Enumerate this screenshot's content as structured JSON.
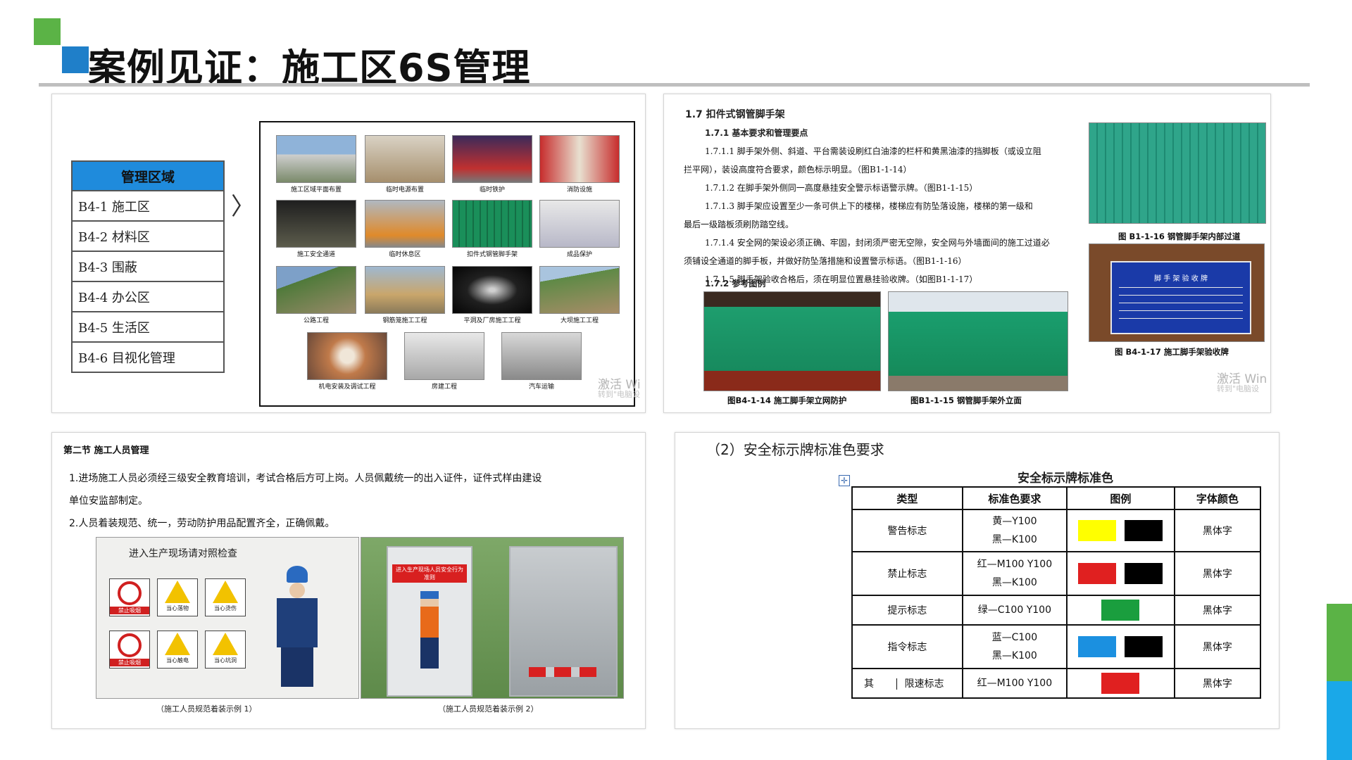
{
  "header": {
    "title": "案例见证：施工区6S管理"
  },
  "panel1": {
    "table_header": "管理区域",
    "areas": [
      "B4-1  施工区",
      "B4-2  材料区",
      "B4-3  围蔽",
      "B4-4  办公区",
      "B4-5  生活区",
      "B4-6  目视化管理"
    ],
    "arrow_glyph": "〉",
    "photo_captions": [
      "施工区域平面布置",
      "临时电源布置",
      "临时铁护",
      "消防设施",
      "施工安全通道",
      "临时休息区",
      "扣件式钢管脚手架",
      "成品保护",
      "公路工程",
      "钢筋笼施工工程",
      "平洞及厂房施工工程",
      "大坝施工工程",
      "机电安装及调试工程",
      "房建工程",
      "汽车运输"
    ],
    "watermark": "激活 Wi",
    "watermark_sub": "转到\"电脑设"
  },
  "panel2": {
    "heading": "1.7  扣件式钢管脚手架",
    "subheading": "1.7.1 基本要求和管理要点",
    "para1a": "1.7.1.1  脚手架外侧、斜道、平台需装设刷红白油漆的栏杆和黄黑油漆的挡脚板（或设立阻",
    "para1b": "拦平网），装设高度符合要求，颜色标示明显。（图B1-1-14）",
    "para2": "1.7.1.2  在脚手架外侧同一高度悬挂安全警示标语警示牌。（图B1-1-15）",
    "para3a": "1.7.1.3  脚手架应设置至少一条可供上下的楼梯，楼梯应有防坠落设施，楼梯的第一级和",
    "para3b": "最后一级踏板须刷防踏空线。",
    "para4a": "1.7.1.4  安全网的架设必须正确、牢固，封闭须严密无空隙，安全网与外墙面间的施工过道必",
    "para4b": "须铺设全通道的脚手板，并做好防坠落措施和设置警示标语。（图B1-1-16）",
    "para5": "1.7.1.5  脚手架验收合格后，须在明显位置悬挂验收牌。（如图B1-1-17）",
    "subheading2": "1.7.2 参考图例",
    "cap_right_top": "图 B1-1-16  钢管脚手架内部过道",
    "cap_right_bottom": "图 B4-1-17 施工脚手架验收牌",
    "cap_left": "图B4-1-14 施工脚手架立网防护",
    "cap_mid": "图B1-1-15  钢管脚手架外立面",
    "sign_title": "脚 手 架 验 收 牌",
    "watermark": "激活 Win",
    "watermark_sub": "转到\"电脑设"
  },
  "panel3": {
    "heading": "第二节  施工人员管理",
    "para1a": "1.进场施工人员必须经三级安全教育培训，考试合格后方可上岗。人员佩戴统一的出入证件，证件式样由建设",
    "para1b": "单位安监部制定。",
    "para2": "2.人员着装规范、统一，劳动防护用品配置齐全，正确佩戴。",
    "poster_title": "进入生产现场请对照检查",
    "sign_labels": [
      "禁止吸烟",
      "当心落物",
      "当心烫伤",
      "禁止吸烟",
      "当心触电",
      "当心坑洞"
    ],
    "board_title": "进入生产现场人员安全行为准则",
    "cap1": "（施工人员规范着装示例 1）",
    "cap2": "（施工人员规范着装示例 2）"
  },
  "panel4": {
    "heading": "（2）安全标示牌标准色要求",
    "table_title": "安全标示牌标准色",
    "columns": [
      "类型",
      "标准色要求",
      "图例",
      "字体颜色"
    ],
    "rows": [
      {
        "type": "警告标志",
        "color_req": [
          "黄—Y100",
          "黑—K100"
        ],
        "swatches": [
          "#ffff00",
          "#000000"
        ],
        "font_color": "黑体字"
      },
      {
        "type": "禁止标志",
        "color_req": [
          "红—M100    Y100",
          "黑—K100"
        ],
        "swatches": [
          "#e02020",
          "#000000"
        ],
        "font_color": "黑体字"
      },
      {
        "type": "提示标志",
        "color_req": [
          "绿—C100    Y100"
        ],
        "swatches": [
          "#1a9e3e"
        ],
        "font_color": "黑体字"
      },
      {
        "type": "指令标志",
        "color_req": [
          "蓝—C100",
          "黑—K100"
        ],
        "swatches": [
          "#1b90e0",
          "#000000"
        ],
        "font_color": "黑体字"
      },
      {
        "type": "限速标志",
        "prefix": "其",
        "color_req": [
          "红—M100    Y100"
        ],
        "swatches": [
          "#e02020"
        ],
        "font_color": "黑体字"
      }
    ]
  },
  "colors": {
    "accent_green": "#5bb346",
    "accent_blue": "#1f7fc9",
    "table_header_blue": "#1f8bdc"
  }
}
